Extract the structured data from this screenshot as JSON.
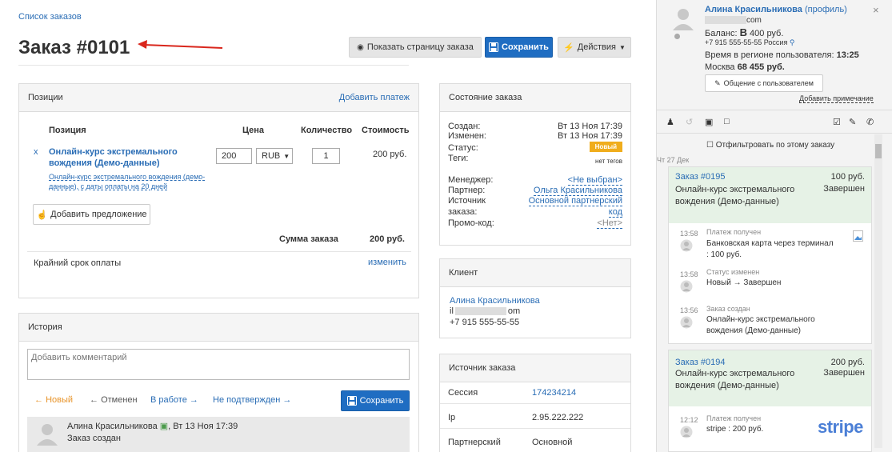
{
  "breadcrumb": "Список заказов",
  "title": "Заказ #0101",
  "toolbar": {
    "show_page": "Показать страницу заказа",
    "save": "Сохранить",
    "actions": "Действия"
  },
  "positions": {
    "header": "Позиции",
    "add_payment": "Добавить платеж",
    "col_position": "Позиция",
    "col_price": "Цена",
    "col_qty": "Количество",
    "col_cost": "Стоимость",
    "item": {
      "remove": "x",
      "name": "Онлайн-курс экстремального вождения (Демо-данные)",
      "desc": "Онлайн-курс экстремального вождения (демо-данные), с даты оплаты на 20 дней",
      "price": "200",
      "currency": "RUB",
      "qty": "1",
      "cost": "200 руб."
    },
    "add_offer": "Добавить предложение",
    "sum_label": "Сумма заказа",
    "sum_value": "200 руб.",
    "deadline_label": "Крайний срок оплаты",
    "deadline_change": "изменить"
  },
  "history": {
    "header": "История",
    "comment_placeholder": "Добавить комментарий",
    "statuses": [
      "Новый",
      "Отменен",
      "В работе",
      "Не подтвержден"
    ],
    "save": "Сохранить",
    "entry_author": "Алина Красильникова",
    "entry_date": "Вт 13 Ноя 17:39",
    "entry_text": "Заказ создан"
  },
  "state": {
    "header": "Состояние заказа",
    "created_label": "Создан:",
    "created_value": "Вт 13 Ноя 17:39",
    "changed_label": "Изменен:",
    "changed_value": "Вт 13 Ноя 17:39",
    "status_label": "Статус:",
    "status_value": "Новый",
    "tags_label": "Теги:",
    "tags_value": "нет тегов",
    "manager_label": "Менеджер:",
    "manager_value": "<Не выбран>",
    "partner_label": "Партнер:",
    "partner_value": "Ольга Красильникова",
    "source_label1": "Источник",
    "source_label2": "заказа:",
    "source_value1": "Основной партнерский",
    "source_value2": "код",
    "promo_label": "Промо-код:",
    "promo_value": "<Нет>",
    "status_color": "#f0ad1c"
  },
  "client": {
    "header": "Клиент",
    "name": "Алина Красильникова",
    "email_start": "il",
    "email_end": "om",
    "phone": "+7 915 555-55-55"
  },
  "source": {
    "header": "Источник заказа",
    "session_label": "Сессия",
    "session_value": "174234214",
    "ip_label": "Ip",
    "ip_value": "2.95.222.222",
    "partner_label": "Партнерский",
    "partner_value": "Основной"
  },
  "sidebar": {
    "user_name": "Алина Красильникова",
    "profile": "(профиль)",
    "email_end": "com",
    "balance_label": "Баланс:",
    "balance_value": "400 руб.",
    "phone_line": "+7 915 555-55-55 Россия",
    "region_time_label": "Время в регионе пользователя:",
    "region_time": "13:25",
    "city": "Москва",
    "city_sum": "68 455 руб.",
    "chat_btn": "Общение с пользователем",
    "add_note": "Добавить примечание",
    "filter_label": "Отфильтровать по этому заказу",
    "date_marker": "Чт 27 Дек",
    "order1": {
      "title": "Заказ #0195",
      "sum": "100 руб.",
      "product": "Онлайн-курс экстремального вождения (Демо-данные)",
      "status": "Завершен",
      "events": [
        {
          "time": "13:58",
          "title": "Платеж получен",
          "text": "Банковская карта через терминал : 100 руб."
        },
        {
          "time": "13:58",
          "title": "Статус изменен",
          "text": "Новый → Завершен"
        },
        {
          "time": "13:56",
          "title": "Заказ создан",
          "text": "Онлайн-курс экстремального вождения (Демо-данные)"
        }
      ]
    },
    "order2": {
      "title": "Заказ #0194",
      "sum": "200 руб.",
      "product": "Онлайн-курс экстремального вождения (Демо-данные)",
      "status": "Завершен",
      "event_time": "12:12",
      "event_title": "Платеж получен",
      "event_text": "stripe : 200 руб.",
      "stripe_logo": "stripe"
    }
  }
}
